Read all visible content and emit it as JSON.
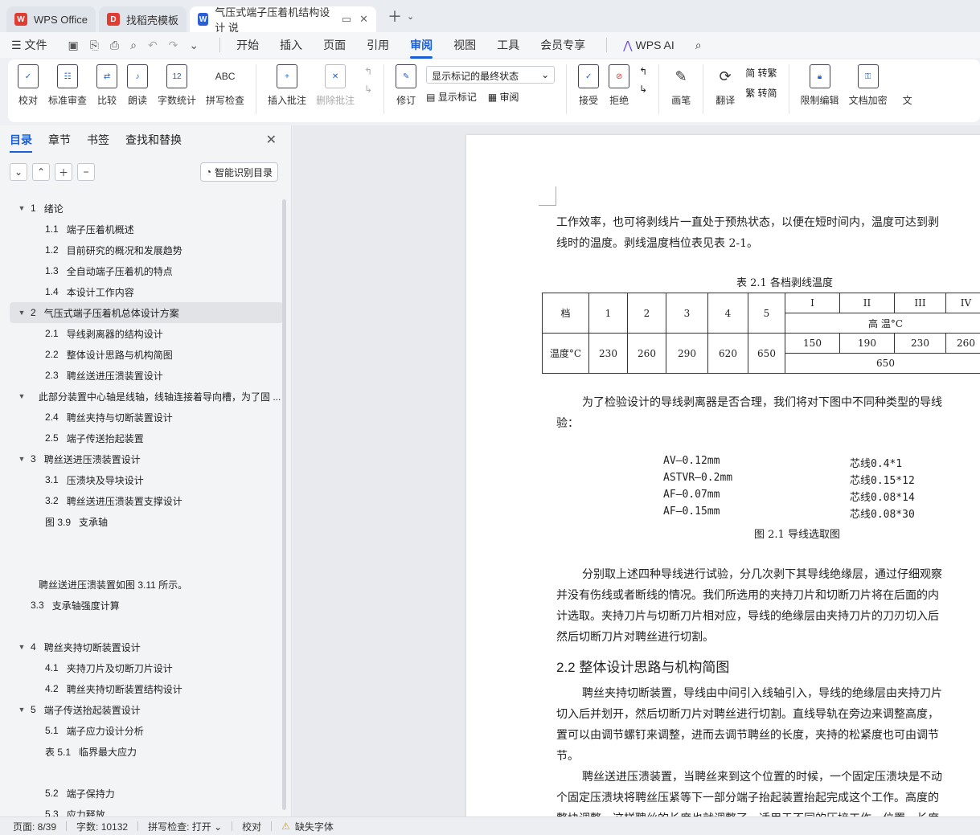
{
  "tabs": [
    {
      "label": "WPS Office",
      "logo": "W",
      "color": "#e03c31"
    },
    {
      "label": "找稻壳模板",
      "logo": "D",
      "color": "#e03c31"
    },
    {
      "label": "气压式端子压着机结构设计 说",
      "logo": "W",
      "color": "#2b5fd9"
    }
  ],
  "menu": {
    "file": "文件",
    "items": [
      "开始",
      "插入",
      "页面",
      "引用",
      "审阅",
      "视图",
      "工具",
      "会员专享"
    ],
    "active": "审阅",
    "ai": "WPS AI"
  },
  "ribbon": {
    "proofread": "校对",
    "standard_review": "标准审查",
    "compare": "比较",
    "read_aloud": "朗读",
    "word_count": "字数统计",
    "spell_check": "拼写检查",
    "insert_comment": "插入批注",
    "delete_comment": "删除批注",
    "revise": "修订",
    "display_state": "显示标记的最终状态",
    "show_marks": "显示标记",
    "review": "审阅",
    "accept": "接受",
    "reject": "拒绝",
    "pen": "画笔",
    "translate": "翻译",
    "to_traditional": "简 转繁",
    "to_simplified": "繁 转简",
    "restrict_edit": "限制编辑",
    "doc_encrypt": "文档加密",
    "more": "文"
  },
  "sidebar": {
    "tabs": [
      "目录",
      "章节",
      "书签",
      "查找和替换"
    ],
    "smart_toc": "智能识别目录",
    "toc": [
      {
        "num": "1",
        "text": "绪论",
        "level": 0,
        "arrow": true
      },
      {
        "num": "1.1",
        "text": "端子压着机概述",
        "level": 1
      },
      {
        "num": "1.2",
        "text": "目前研究的概况和发展趋势",
        "level": 1
      },
      {
        "num": "1.3",
        "text": "全自动端子压着机的特点",
        "level": 1
      },
      {
        "num": "1.4",
        "text": "本设计工作内容",
        "level": 1
      },
      {
        "num": "2",
        "text": "气压式端子压着机总体设计方案",
        "level": 0,
        "arrow": true,
        "selected": true
      },
      {
        "num": "2.1",
        "text": "导线剥离器的结构设计",
        "level": 1
      },
      {
        "num": "2.2",
        "text": "整体设计思路与机构简图",
        "level": 1
      },
      {
        "num": "2.3",
        "text": "聘丝送进压溃装置设计",
        "level": 1
      },
      {
        "num": "",
        "text": "此部分装置中心轴是线轴，线轴连接着导向槽，为了固 ...",
        "level": 0,
        "arrow": true
      },
      {
        "num": "2.4",
        "text": "聘丝夹持与切断装置设计",
        "level": 1
      },
      {
        "num": "2.5",
        "text": "端子传送抬起装置",
        "level": 1
      },
      {
        "num": "3",
        "text": "聘丝送进压溃装置设计",
        "level": 0,
        "arrow": true
      },
      {
        "num": "3.1",
        "text": "压溃块及导块设计",
        "level": 1
      },
      {
        "num": "3.2",
        "text": "聘丝送进压溃装置支撑设计",
        "level": 1
      },
      {
        "num": "图 3.9",
        "text": "支承轴",
        "level": 1
      },
      {
        "num": "",
        "text": "",
        "level": 1
      },
      {
        "num": "",
        "text": "",
        "level": 1
      },
      {
        "num": "",
        "text": "聘丝送进压溃装置如图 3.11 所示。",
        "level": 0
      },
      {
        "num": "3.3",
        "text": "支承轴强度计算",
        "level": 0
      },
      {
        "num": "",
        "text": "",
        "level": 1
      },
      {
        "num": "4",
        "text": "聘丝夹持切断装置设计",
        "level": 0,
        "arrow": true
      },
      {
        "num": "4.1",
        "text": "夹持刀片及切断刀片设计",
        "level": 1
      },
      {
        "num": "4.2",
        "text": "聘丝夹持切断装置结构设计",
        "level": 1
      },
      {
        "num": "5",
        "text": "端子传送抬起装置设计",
        "level": 0,
        "arrow": true
      },
      {
        "num": "5.1",
        "text": "端子应力设计分析",
        "level": 1
      },
      {
        "num": "表 5.1",
        "text": "临界最大应力",
        "level": 1
      },
      {
        "num": "",
        "text": "",
        "level": 1
      },
      {
        "num": "5.2",
        "text": "端子保持力",
        "level": 1
      },
      {
        "num": "5.3",
        "text": "应力释放",
        "level": 1
      }
    ]
  },
  "document": {
    "para1_l1": "工作效率，也可将剥线片一直处于预热状态，以便在短时间内，温度可达到剥",
    "para1_l2": "线时的温度。剥线温度档位表见表 2-1。",
    "table_caption": "表 2.1  各档剥线温度",
    "table": {
      "h_dang": "档",
      "nums": [
        "1",
        "2",
        "3",
        "4",
        "5"
      ],
      "romans": [
        "I",
        "II",
        "III",
        "IV"
      ],
      "high_temp": "高 温°C",
      "temp_label": "温度°C",
      "temps": [
        "230",
        "260",
        "290",
        "620",
        "650"
      ],
      "high_vals": [
        "150",
        "190",
        "230",
        "260"
      ],
      "high_total": "650"
    },
    "para2_l1": "为了检验设计的导线剥离器是否合理，我们将对下图中不同种类型的导线",
    "para2_l2": "验：",
    "wires": [
      {
        "a": "AV—0.12mm",
        "b": "芯线0.4*1"
      },
      {
        "a": "ASTVR—0.2mm",
        "b": "芯线0.15*12"
      },
      {
        "a": "AF—0.07mm",
        "b": "芯线0.08*14"
      },
      {
        "a": "AF—0.15mm",
        "b": "芯线0.08*30"
      }
    ],
    "fig_caption": "图 2.1  导线选取图",
    "para3": [
      "分别取上述四种导线进行试验，分几次剥下其导线绝缘层，通过仔细观察",
      "并没有伤线或者断线的情况。我们所选用的夹持刀片和切断刀片将在后面的内",
      "计选取。夹持刀片与切断刀片相对应，导线的绝缘层由夹持刀片的刀刃切入后",
      "然后切断刀片对聘丝进行切割。"
    ],
    "heading": "2.2   整体设计思路与机构简图",
    "para4": [
      "聘丝夹持切断装置，导线由中间引入线轴引入，导线的绝缘层由夹持刀片",
      "切入后并划开，然后切断刀片对聘丝进行切割。直线导轨在旁边来调整高度，",
      "置可以由调节螺钉来调整，进而去调节聘丝的长度，夹持的松紧度也可由调节",
      "节。"
    ],
    "para5": [
      "聘丝送进压溃装置，当聘丝来到这个位置的时候，一个固定压溃块是不动",
      "个固定压溃块将聘丝压紧等下一部分端子抬起装置抬起完成这个工作。高度的",
      "整块调整，这样聘丝的长度也就调整了，适用于不同的压接工作，位置，长度"
    ]
  },
  "status": {
    "page": "页面: 8/39",
    "words": "字数: 10132",
    "spell": "拼写检查: 打开",
    "proof": "校对",
    "missing_font": "缺失字体"
  }
}
